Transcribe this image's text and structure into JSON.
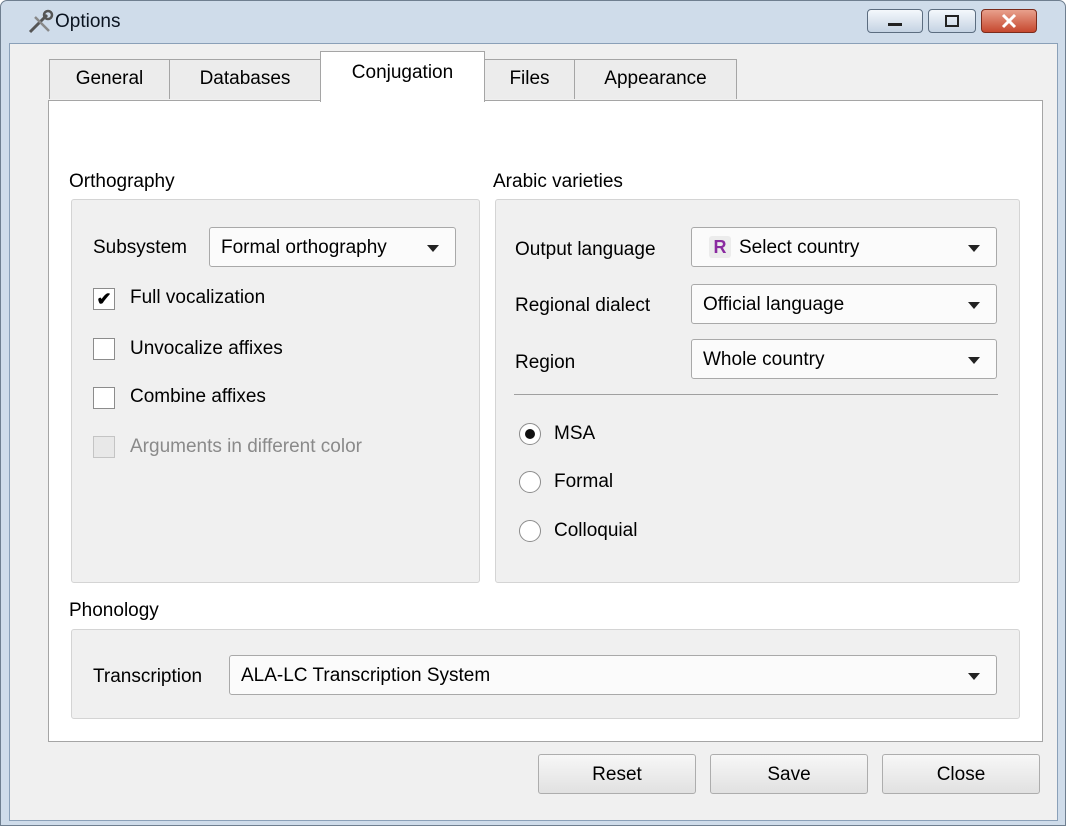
{
  "window": {
    "title": "Options"
  },
  "tabs": [
    "General",
    "Databases",
    "Conjugation",
    "Files",
    "Appearance"
  ],
  "orthography": {
    "heading": "Orthography",
    "subsystem_label": "Subsystem",
    "subsystem_value": "Formal orthography",
    "checks": [
      {
        "label": "Full vocalization",
        "checked": true,
        "enabled": true
      },
      {
        "label": "Unvocalize affixes",
        "checked": false,
        "enabled": true
      },
      {
        "label": "Combine affixes",
        "checked": false,
        "enabled": true
      },
      {
        "label": "Arguments in different color",
        "checked": false,
        "enabled": false
      }
    ]
  },
  "varieties": {
    "heading": "Arabic varieties",
    "output_label": "Output language",
    "output_badge": "R",
    "output_value": "Select country",
    "dialect_label": "Regional dialect",
    "dialect_value": "Official language",
    "region_label": "Region",
    "region_value": "Whole country",
    "radios": [
      {
        "label": "MSA",
        "selected": true
      },
      {
        "label": "Formal",
        "selected": false
      },
      {
        "label": "Colloquial",
        "selected": false
      }
    ]
  },
  "phonology": {
    "heading": "Phonology",
    "transcription_label": "Transcription",
    "transcription_value": "ALA-LC Transcription System"
  },
  "buttons": {
    "reset": "Reset",
    "save": "Save",
    "close": "Close"
  },
  "colors": {
    "accent_badge": "#8a2aa0",
    "titlebar": "#cfdcea"
  },
  "checkmark": "✔"
}
